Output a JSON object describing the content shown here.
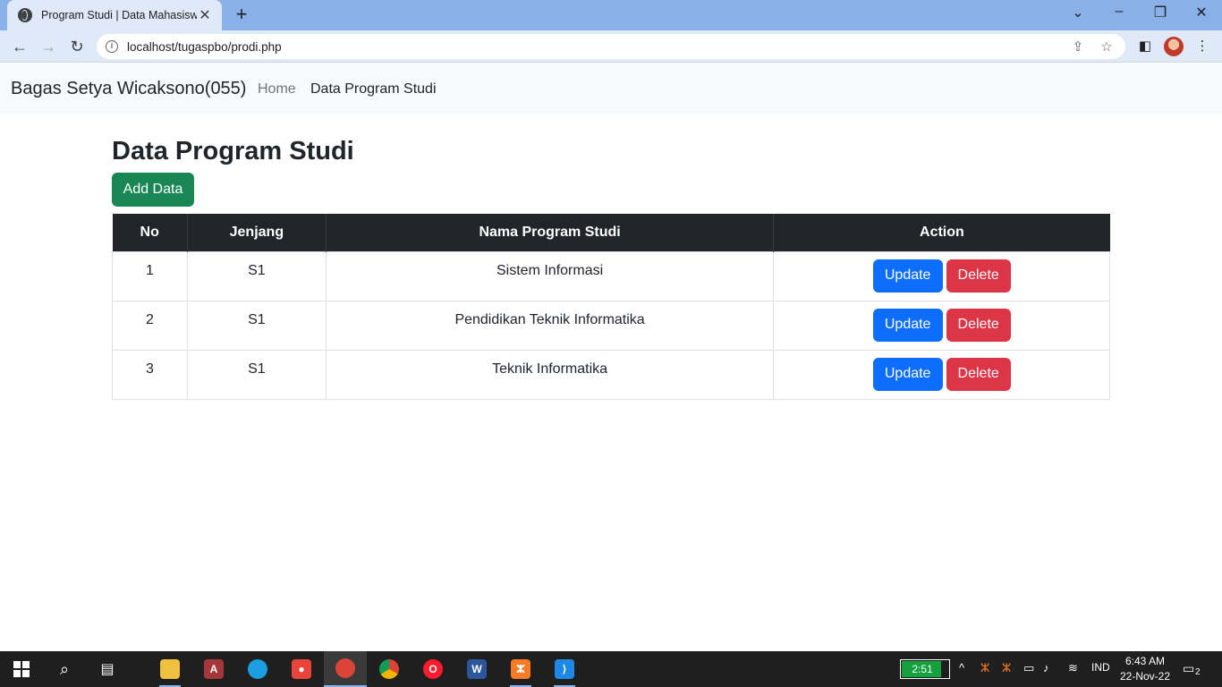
{
  "browser": {
    "tab_title": "Program Studi | Data Mahasiswa",
    "url": "localhost/tugaspbo/prodi.php"
  },
  "navbar": {
    "brand": "Bagas Setya Wicaksono(055)",
    "links": [
      "Home",
      "Data Program Studi"
    ]
  },
  "page": {
    "title": "Data Program Studi",
    "add_button": "Add Data",
    "table": {
      "headers": [
        "No",
        "Jenjang",
        "Nama Program Studi",
        "Action"
      ],
      "rows": [
        {
          "no": "1",
          "jenjang": "S1",
          "nama": "Sistem Informasi"
        },
        {
          "no": "2",
          "jenjang": "S1",
          "nama": "Pendidikan Teknik Informatika"
        },
        {
          "no": "3",
          "jenjang": "S1",
          "nama": "Teknik Informatika"
        }
      ],
      "update_label": "Update",
      "delete_label": "Delete"
    }
  },
  "taskbar": {
    "battery_time": "2:51",
    "language": "IND",
    "time": "6:43 AM",
    "date": "22-Nov-22",
    "notification_count": "2"
  },
  "colors": {
    "add": "#198754",
    "update": "#0d6efd",
    "delete": "#dc3545",
    "table_header": "#212529"
  }
}
